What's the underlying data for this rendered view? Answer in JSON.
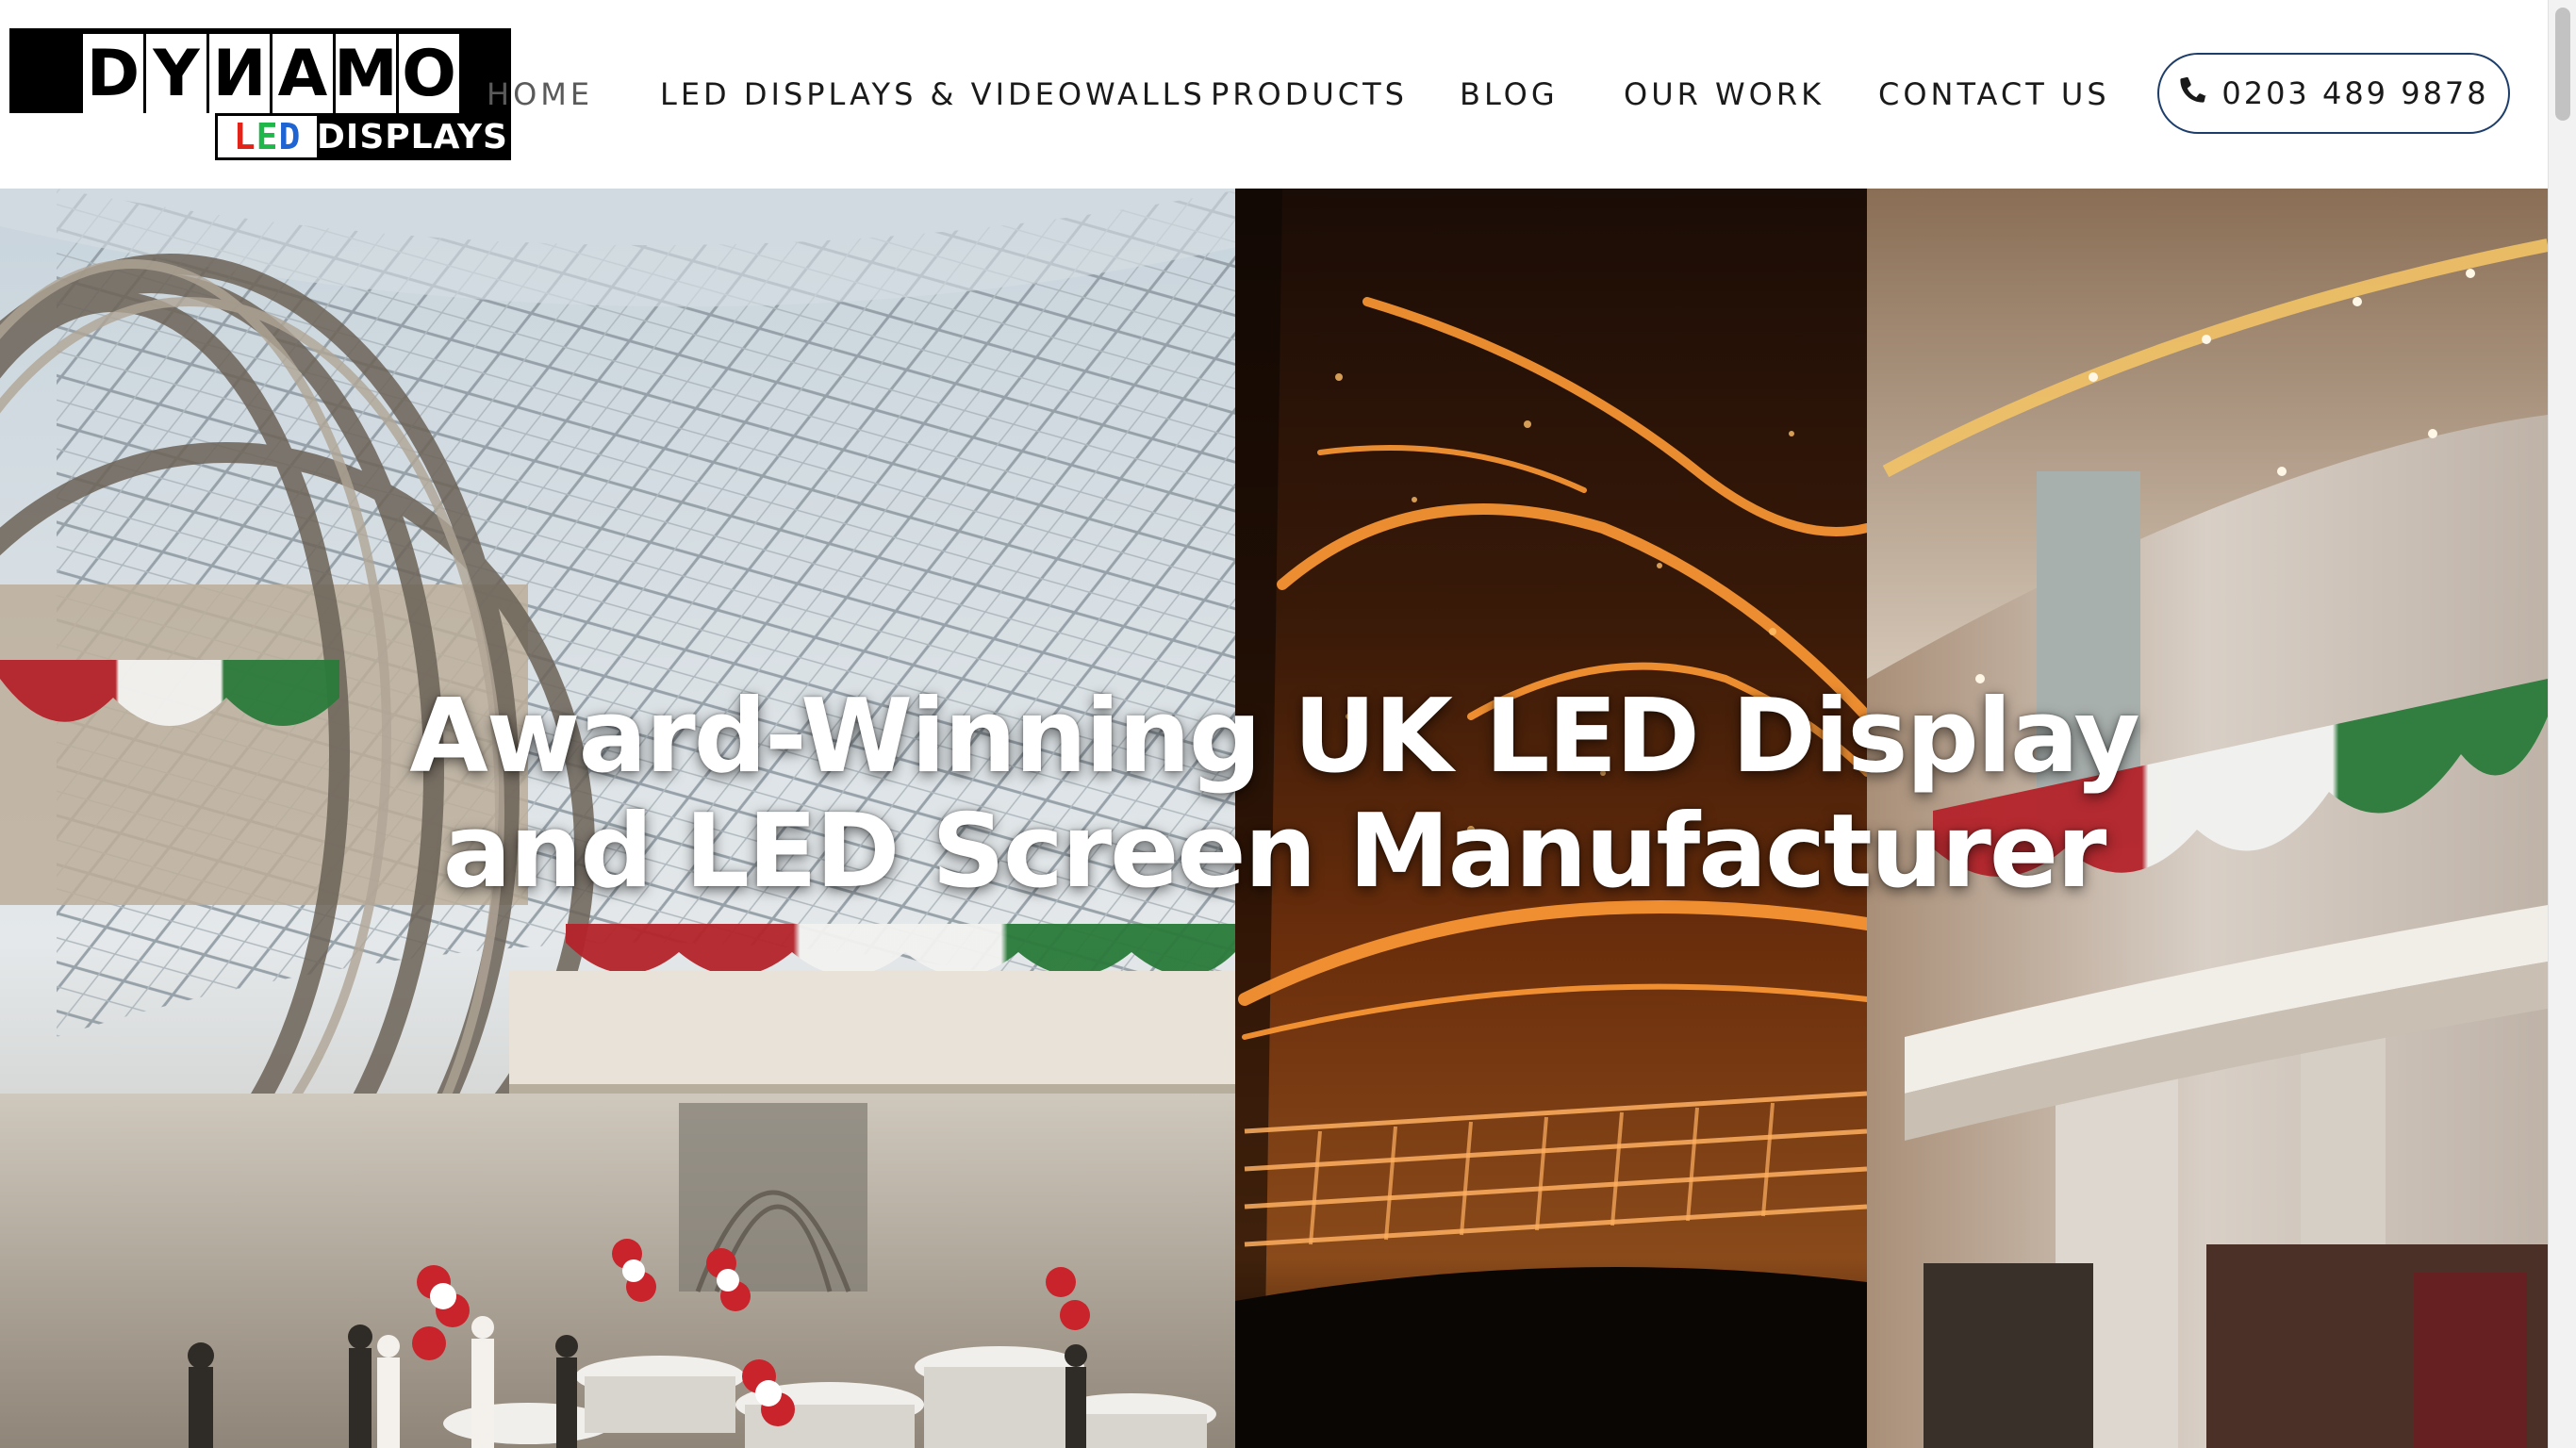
{
  "brand": {
    "logo_letters": [
      "D",
      "Y",
      "N",
      "A",
      "M",
      "O"
    ],
    "logo_led_parts": [
      "L",
      "E",
      "D"
    ],
    "logo_displays": "DISPLAYS"
  },
  "nav": {
    "items": [
      {
        "label": "HOME",
        "active": true
      },
      {
        "label": "LED DISPLAYS & VIDEOWALLS",
        "active": false
      },
      {
        "label": "PRODUCTS",
        "active": false
      },
      {
        "label": "BLOG",
        "active": false
      },
      {
        "label": "OUR WORK",
        "active": false
      },
      {
        "label": "CONTACT US",
        "active": false
      }
    ],
    "phone": "0203 489 9878",
    "phone_icon": "phone-icon"
  },
  "hero": {
    "title_line1": "Award-Winning UK LED Display",
    "title_line2": "and LED Screen Manufacturer"
  },
  "colors": {
    "phone_border": "#1d3d6b",
    "nav_text": "#1a1a1a",
    "hero_text": "#ffffff"
  }
}
